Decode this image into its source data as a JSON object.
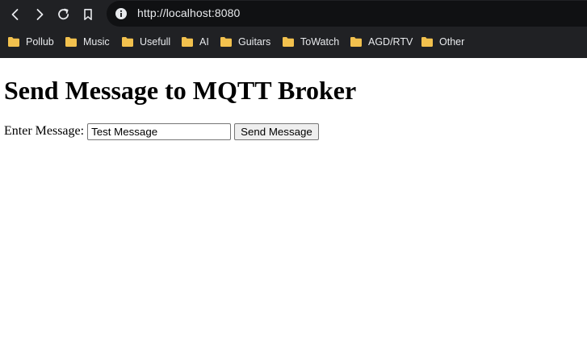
{
  "browser": {
    "url": "http://localhost:8080",
    "icons": {
      "back": "arrow-left-icon",
      "forward": "arrow-right-icon",
      "reload": "reload-icon",
      "bookmark": "bookmark-icon",
      "site_info": "info-icon",
      "folder": "folder-icon"
    },
    "bookmarks": [
      {
        "label": "Pollub"
      },
      {
        "label": "Music"
      },
      {
        "label": "Usefull"
      },
      {
        "label": "AI"
      },
      {
        "label": "Guitars"
      },
      {
        "label": "ToWatch"
      },
      {
        "label": "AGD/RTV"
      },
      {
        "label": "Other"
      }
    ]
  },
  "page": {
    "title": "Send Message to MQTT Broker",
    "form": {
      "label": "Enter Message:",
      "input_value": "Test Message",
      "button_label": "Send Message"
    }
  },
  "colors": {
    "chrome_bg": "#202124",
    "omnibox_bg": "#101113",
    "folder": "#f2c14e",
    "page_bg": "#ffffff"
  }
}
